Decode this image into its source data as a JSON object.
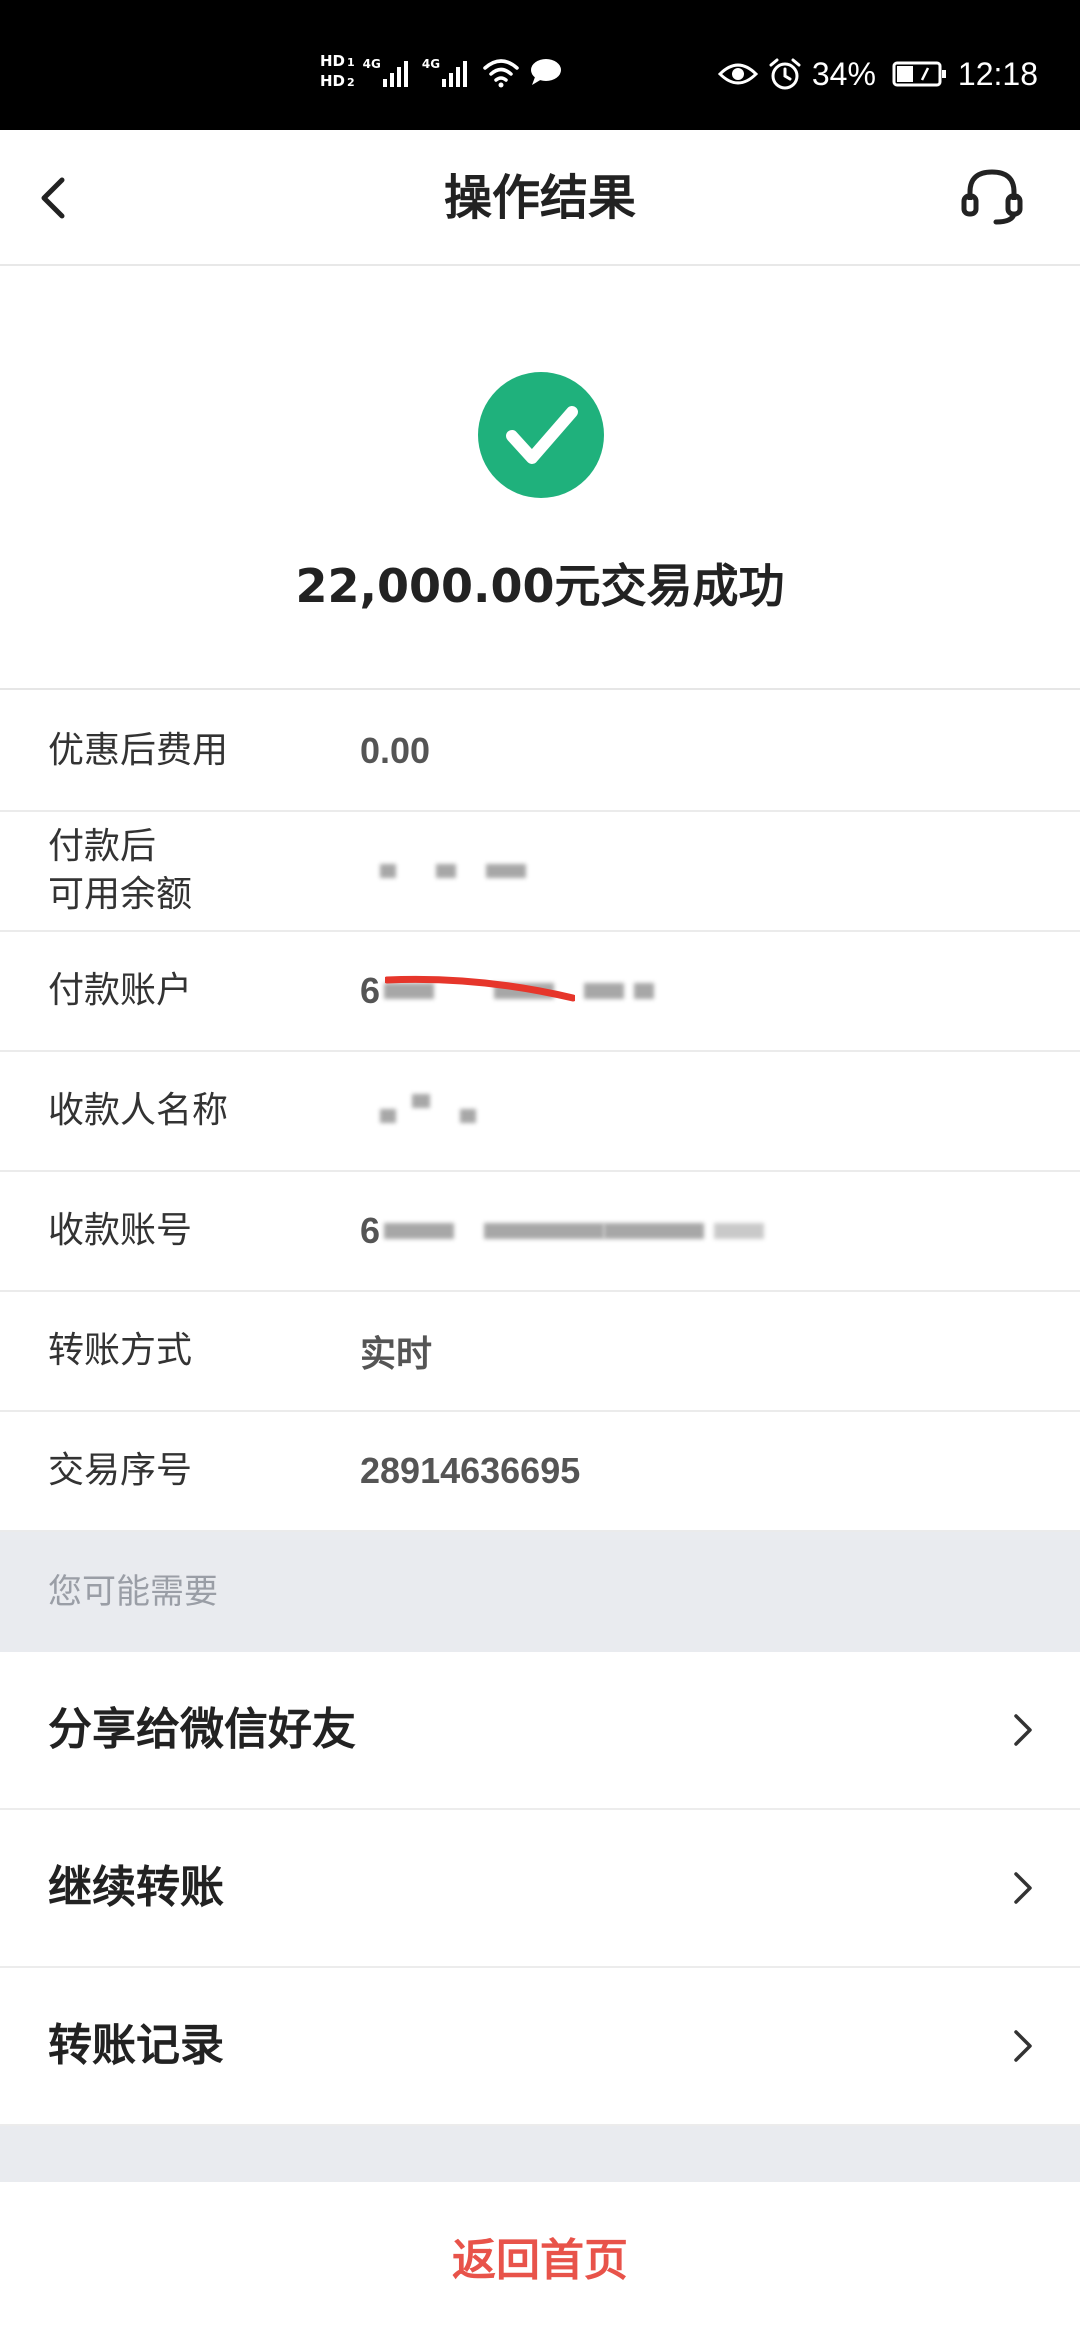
{
  "status_bar": {
    "hd_labels": [
      "HD",
      "HD"
    ],
    "hd_numbers": [
      "1",
      "2"
    ],
    "signal_labels": [
      "4G",
      "4G"
    ],
    "battery": "34%",
    "time": "12:18",
    "icons": [
      "wifi-icon",
      "chat-icon",
      "eye-icon",
      "alarm-icon",
      "battery-icon"
    ]
  },
  "header": {
    "title": "操作结果",
    "icons": [
      "back-icon",
      "headset-icon"
    ]
  },
  "result": {
    "text": "22,000.00元交易成功",
    "icon": "check-circle-icon",
    "color": "#1fb17c"
  },
  "details": [
    {
      "label": "优惠后费用",
      "value": "0.00"
    },
    {
      "label": "付款后\n可用余额",
      "value": ""
    },
    {
      "label": "付款账户",
      "value": "6"
    },
    {
      "label": "收款人名称",
      "value": ""
    },
    {
      "label": "收款账号",
      "value": "6"
    },
    {
      "label": "转账方式",
      "value": "实时"
    },
    {
      "label": "交易序号",
      "value": "28914636695"
    }
  ],
  "suggestions": {
    "title": "您可能需要",
    "items": [
      "分享给微信好友",
      "继续转账",
      "转账记录"
    ]
  },
  "footer": {
    "home_label": "返回首页",
    "color": "#e8534a"
  },
  "colors": {
    "redact_mark": "#e6362b",
    "section_bg": "#e9ebef"
  }
}
